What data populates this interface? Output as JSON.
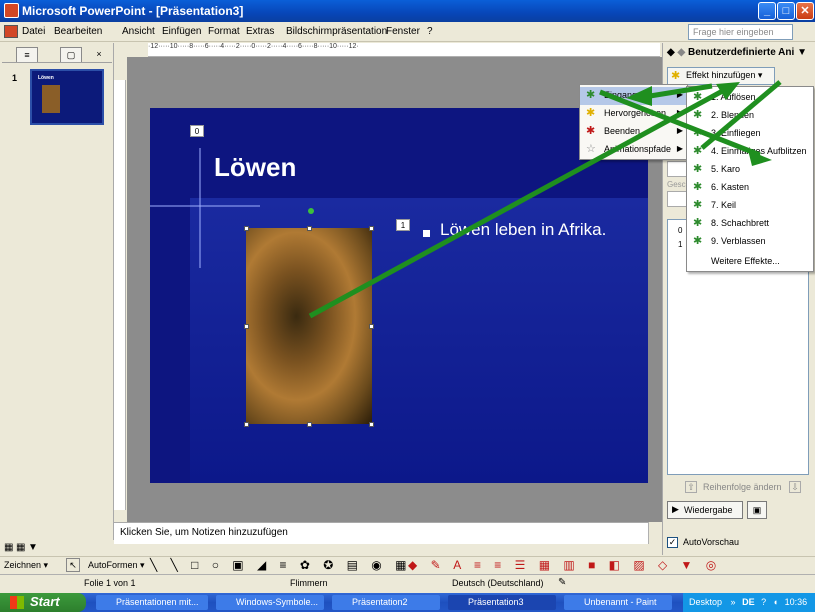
{
  "window": {
    "title": "Microsoft PowerPoint - [Präsentation3]",
    "minimize": "_",
    "maximize": "□",
    "close": "✕"
  },
  "menubar": {
    "items": [
      "Datei",
      "Bearbeiten",
      "Ansicht",
      "Einfügen",
      "Format",
      "Extras",
      "Bildschirmpräsentation",
      "Fenster",
      "?"
    ],
    "help_placeholder": "Frage hier eingeben"
  },
  "leftpane": {
    "slide_number": "1",
    "thumb_title": "Löwen",
    "close": "×"
  },
  "ruler": {
    "text": "·12·····10·····8·····6·····4·····2·····0·····2·····4·····6·····8·····10·····12·"
  },
  "slide": {
    "title": "Löwen",
    "bullet": "Löwen leben in Afrika.",
    "tag_title": "0",
    "tag_bullet": "1"
  },
  "notes": {
    "placeholder": "Klicken Sie, um Notizen hinzuzufügen"
  },
  "taskpane": {
    "title": "Benutzerdefinierte Ani",
    "effect_button": "Effekt hinzufügen",
    "list_rows": [
      "0",
      "1"
    ],
    "order_label": "Reihenfolge ändern",
    "play_button": "Wiedergabe",
    "autopreview_label": "AutoVorschau",
    "autopreview_checked": true,
    "side_labels": [
      "Gesc"
    ]
  },
  "menu1": {
    "items": [
      {
        "label": "Eingang",
        "icon": "green-star-icon",
        "has_submenu": true,
        "selected": true
      },
      {
        "label": "Hervorgehoben",
        "icon": "yellow-star-icon",
        "has_submenu": false,
        "selected": false
      },
      {
        "label": "Beenden",
        "icon": "red-star-icon",
        "has_submenu": true,
        "selected": false
      },
      {
        "label": "Animationspfade",
        "icon": "outline-star-icon",
        "has_submenu": true,
        "selected": false
      }
    ]
  },
  "menu2": {
    "items": [
      "1. Auflösen",
      "2. Blenden",
      "3. Einfliegen",
      "4. Einmaliges Aufblitzen",
      "5. Karo",
      "6. Kasten",
      "7. Keil",
      "8. Schachbrett",
      "9. Verblassen"
    ],
    "more": "Weitere Effekte..."
  },
  "drawbar": {
    "draw_label": "Zeichnen",
    "autoshapes_label": "AutoFormen"
  },
  "statusbar": {
    "slide": "Folie 1 von 1",
    "design": "Flimmern",
    "language": "Deutsch (Deutschland)"
  },
  "taskbar": {
    "start": "Start",
    "items": [
      "Präsentationen mit...",
      "Windows-Symbole...",
      "Präsentation2",
      "Präsentation3",
      "Unbenannt - Paint"
    ],
    "desktop": "Desktop",
    "lang": "DE",
    "time": "10:36"
  }
}
